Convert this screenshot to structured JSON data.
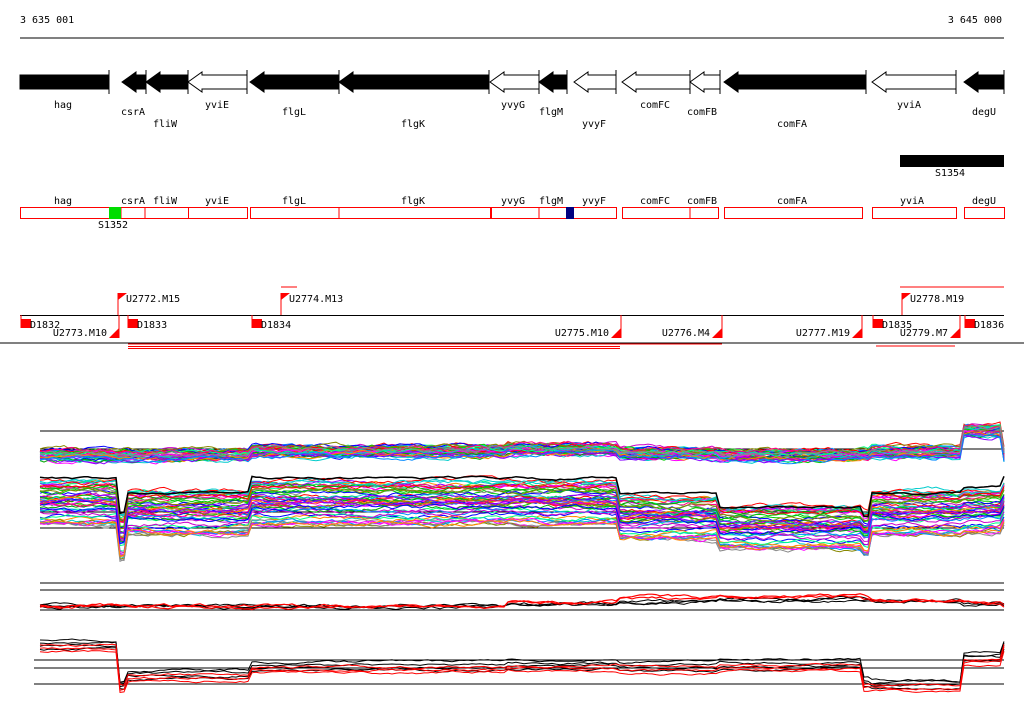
{
  "ruler": {
    "start_label": "3 635 001",
    "end_label": "3 645 000"
  },
  "genes": [
    {
      "name": "hag",
      "filled": true,
      "strand": "none"
    },
    {
      "name": "csrA",
      "filled": true,
      "strand": "-"
    },
    {
      "name": "fliW",
      "filled": true,
      "strand": "-"
    },
    {
      "name": "yviE",
      "filled": false,
      "strand": "-"
    },
    {
      "name": "flgL",
      "filled": true,
      "strand": "-"
    },
    {
      "name": "flgK",
      "filled": true,
      "strand": "-"
    },
    {
      "name": "yvyG",
      "filled": false,
      "strand": "-"
    },
    {
      "name": "flgM",
      "filled": true,
      "strand": "-"
    },
    {
      "name": "yvyF",
      "filled": false,
      "strand": "-"
    },
    {
      "name": "comFC",
      "filled": false,
      "strand": "-"
    },
    {
      "name": "comFB",
      "filled": false,
      "strand": "-"
    },
    {
      "name": "comFA",
      "filled": true,
      "strand": "-"
    },
    {
      "name": "yviA",
      "filled": false,
      "strand": "-"
    },
    {
      "name": "degU",
      "filled": true,
      "strand": "-"
    }
  ],
  "feature_bar": {
    "label": "S1354"
  },
  "gene_boxes": [
    "hag",
    "csrA",
    "fliW",
    "yviE",
    "flgL",
    "flgK",
    "yvyG",
    "flgM",
    "yvyF",
    "comFC",
    "comFB",
    "comFA",
    "yviA",
    "degU"
  ],
  "box_marker": {
    "label": "S1352",
    "colors": {
      "green": "#00dd00",
      "navy": "#000080"
    }
  },
  "upshifts": [
    "U2772.M15",
    "U2774.M13",
    "U2778.M19"
  ],
  "downshifts": [
    "U2773.M10",
    "U2775.M10",
    "U2776.M4",
    "U2777.M19",
    "U2779.M7"
  ],
  "d_features": [
    "D1832",
    "D1833",
    "D1834",
    "D1835",
    "D1836"
  ],
  "colors": {
    "accent": "#ff0000",
    "gene": "#000000"
  }
}
